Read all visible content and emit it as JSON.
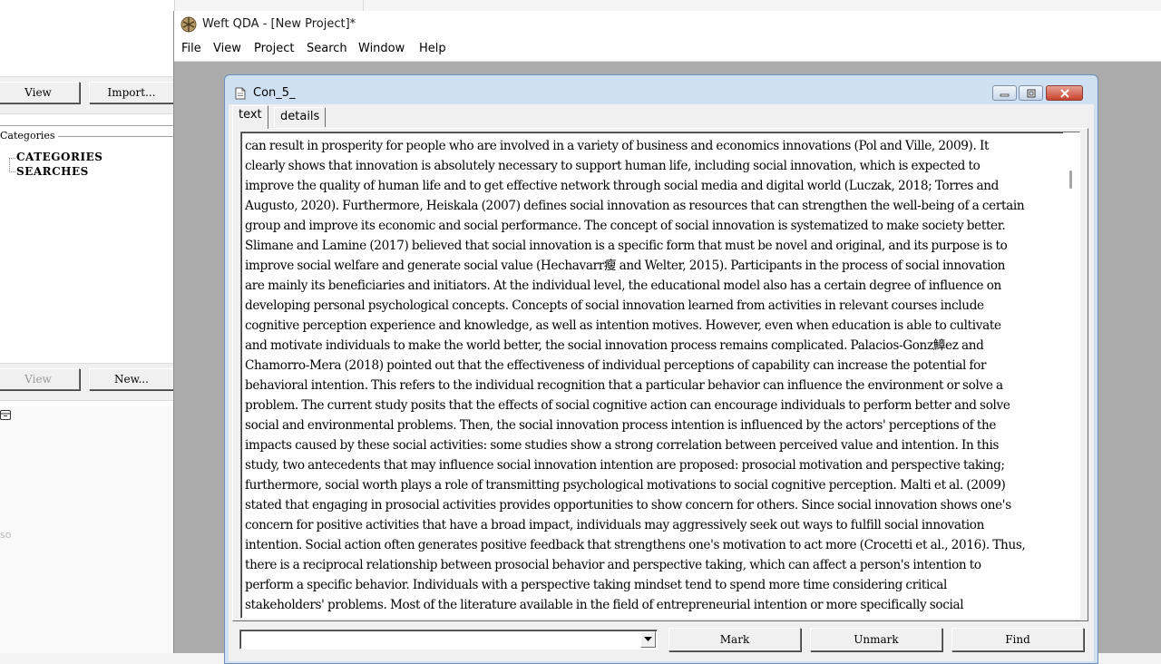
{
  "background_window": {
    "toolbar_top": {
      "view_label": "View",
      "import_label": "Import..."
    },
    "categories_group_label": "Categories",
    "tree": [
      "CATEGORIES",
      "SEARCHES"
    ],
    "toolbar_bottom": {
      "view_label": "View",
      "new_label": "New..."
    },
    "faint_text": "so"
  },
  "app": {
    "title": "Weft QDA - [New Project]*",
    "menu": [
      "File",
      "View",
      "Project",
      "Search",
      "Window",
      "Help"
    ]
  },
  "document_window": {
    "title": "Con_5_",
    "tabs": [
      {
        "label": "text",
        "active": true
      },
      {
        "label": "details",
        "active": false
      }
    ],
    "text_lines": [
      "can result in prosperity for people who are involved in a variety of business and economics innovations (Pol and Ville, 2009). It",
      "clearly shows that innovation is absolutely necessary to support human life, including social innovation, which is expected to",
      "improve the quality of human life and to get effective network through social media and digital world (Luczak, 2018; Torres and",
      "Augusto, 2020). Furthermore, Heiskala (2007) defines social innovation as resources that can strengthen the well-being of a certain",
      "group and improve its economic and social performance. The concept of social innovation is systematized to make society better.",
      "Slimane and Lamine (2017) believed that social innovation is a specific form that must be novel and original, and its purpose is to",
      "improve social welfare and generate social value (Hechavarr瘦 and Welter, 2015). Participants in the process of social innovation",
      "are mainly its beneficiaries and initiators. At the individual level, the educational model also has a certain degree of influence on",
      "developing personal psychological concepts. Concepts of social innovation learned from activities in relevant courses include",
      "cognitive perception experience and knowledge, as well as intention motives. However, even when education is able to cultivate",
      "and motivate individuals to make the world better, the social innovation process remains complicated. Palacios-Gonz鱆ez and",
      "Chamorro-Mera (2018) pointed out that the effectiveness of individual perceptions of capability can increase the potential for",
      "behavioral intention. This refers to the individual recognition that a particular behavior can influence the environment or solve a",
      "problem. The current study posits that the effects of social cognitive action can encourage individuals to perform better and solve",
      "social and environmental problems. Then, the social innovation process intention is influenced by the actors' perceptions of the",
      "impacts caused by these social activities: some studies show a strong correlation between perceived value and intention. In this",
      "study, two antecedents that may influence social innovation intention are proposed: prosocial motivation and perspective taking;",
      "furthermore, social worth plays a role of transmitting psychological motivations to social cognitive perception. Malti et al. (2009)",
      "stated that engaging in prosocial activities provides opportunities to show concern for others. Since social innovation shows one's",
      "concern for positive activities that have a broad impact, individuals may aggressively seek out ways to fulfill social innovation",
      "intention. Social action often generates positive feedback that strengthens one's motivation to act more (Crocetti et  al., 2016). Thus,",
      "there is a reciprocal relationship between prosocial behavior and perspective taking, which can affect a person's intention to",
      "perform a specific behavior. Individuals with a perspective taking mindset tend to spend more time considering critical",
      "stakeholders' problems. Most of the literature available in the field of entrepreneurial intention or more specifically social"
    ],
    "combo_value": "",
    "buttons": {
      "mark": "Mark",
      "unmark": "Unmark",
      "find": "Find"
    }
  }
}
